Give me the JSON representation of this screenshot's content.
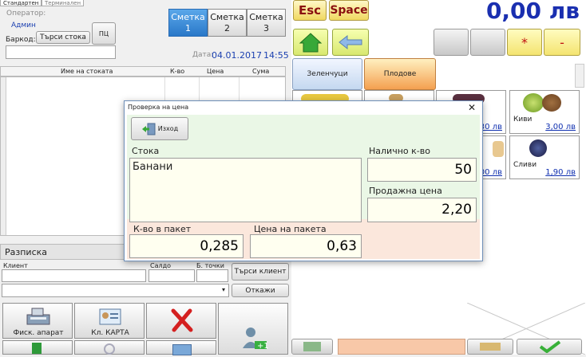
{
  "tabs": [
    "Стандартен",
    "Терминален"
  ],
  "operator": {
    "label": "Оператор:",
    "name": "Админ"
  },
  "barcode": {
    "label": "Баркод:",
    "search_button": "Търси стока",
    "pc_button": "ПЦ",
    "value": ""
  },
  "smetki": [
    {
      "label": "Сметка",
      "number": "1",
      "active": true
    },
    {
      "label": "Сметка",
      "number": "2",
      "active": false
    },
    {
      "label": "Сметка",
      "number": "3",
      "active": false
    }
  ],
  "date": {
    "label": "Дата:",
    "value": "04.01.2017",
    "time": "14:55"
  },
  "grid": {
    "columns": [
      "Име на стоката",
      "К-во",
      "Цена",
      "Сума"
    ]
  },
  "razpiska": {
    "title": "Разписка",
    "client_label": "Клиент",
    "saldo_label": "Салдо",
    "points_label": "Б. точки",
    "search_client": "Търси клиент",
    "cancel": "Откажи"
  },
  "bottom_buttons": {
    "fiscal": "Фиск. апарат",
    "card": "Кл. КАРТА"
  },
  "top_right": {
    "esc": "Esc",
    "space": "Space",
    "total": "0,00 лв"
  },
  "keys": {
    "star": "*",
    "minus": "-"
  },
  "categories": [
    "Зеленчуци",
    "Плодове"
  ],
  "tiles": [
    {
      "name": "Киви",
      "price": "3,00 лв"
    },
    {
      "name": "Сливи",
      "price": "1,90 лв"
    }
  ],
  "partial_prices": {
    "row1": "30 лв",
    "row2": "00 лв"
  },
  "dialog": {
    "title": "Проверка на цена",
    "exit": "Изход",
    "item_label": "Стока",
    "item_value": "Банани",
    "stock_label": "Налично к-во",
    "stock_value": "50",
    "price_label": "Продажна цена",
    "price_value": "2,20",
    "pack_qty_label": "К-во в пакет",
    "pack_qty_value": "0,285",
    "pack_price_label": "Цена на пакета",
    "pack_price_value": "0,63",
    "close": "✕"
  },
  "colors": {
    "accent": "#2a78c8",
    "total": "#1a2fb0",
    "dialog_green": "#eaf7e6",
    "dialog_pink": "#fbe7dc"
  }
}
